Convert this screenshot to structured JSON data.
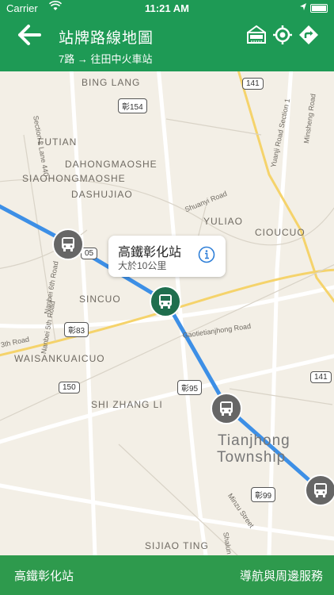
{
  "status_bar": {
    "carrier": "Carrier",
    "time": "11:21 AM"
  },
  "header": {
    "title": "站牌路線地圖",
    "subtitle": "7路 → 往田中火車站"
  },
  "map": {
    "labels": [
      "BING LANG",
      "FUTIAN",
      "DAHONGMAOSHE",
      "SIAOHONGMAOSHE",
      "DASHUJIAO",
      "YULIAO",
      "CIOUCUO",
      "SINCUO",
      "WAISANKUAICUO",
      "SHI ZHANG LI",
      "SIJIAO TING",
      "Tianjhong",
      "Township"
    ],
    "road_labels": [
      "Section 2 Lane 440",
      "Yuanji Road Section 1",
      "Minsheng Road",
      "Shuanyi Road",
      "Nanbei 5th Road",
      "Nanbei 6th Road",
      "Gaotietianjhong Road",
      "Minzu Street",
      "3th Road",
      "Shalun"
    ],
    "shields": [
      "141",
      "彰154",
      "彰83",
      "150",
      "彰95",
      "141",
      "彰99",
      "05"
    ],
    "callout": {
      "title": "高鐵彰化站",
      "distance": "大於10公里"
    }
  },
  "footer": {
    "stop_name": "高鐵彰化站",
    "nav_label": "導航與周邊服務"
  },
  "colors": {
    "header": "#1e9a55",
    "footer": "#2e9a4d",
    "route": "#3d8fe6",
    "active_stop": "#1f6e4e"
  },
  "icons": [
    "back-arrow-icon",
    "hotel-icon",
    "locate-icon",
    "directions-icon",
    "bus-icon",
    "info-icon"
  ]
}
